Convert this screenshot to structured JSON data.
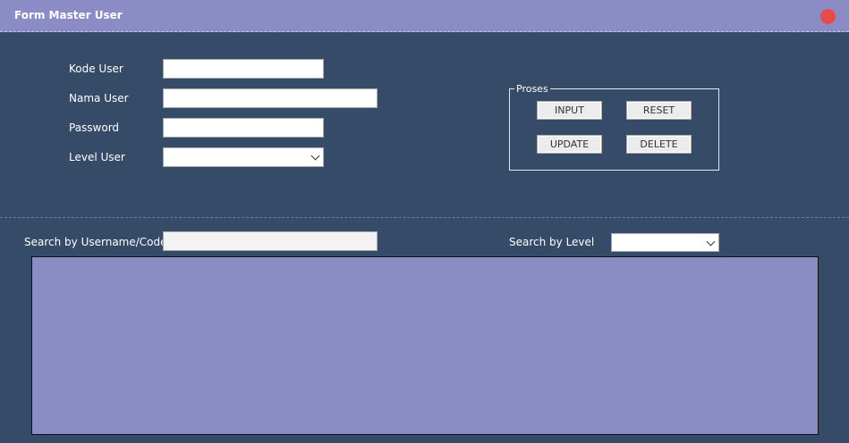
{
  "window": {
    "title": "Form Master User"
  },
  "form": {
    "kode_user_label": "Kode User",
    "kode_user_value": "",
    "nama_user_label": "Nama User",
    "nama_user_value": "",
    "password_label": "Password",
    "password_value": "",
    "level_user_label": "Level User",
    "level_user_value": ""
  },
  "proses": {
    "legend": "Proses",
    "input_label": "INPUT",
    "reset_label": "RESET",
    "update_label": "UPDATE",
    "delete_label": "DELETE"
  },
  "search": {
    "by_username_label": "Search by Username/Code",
    "by_username_value": "",
    "by_level_label": "Search by Level",
    "by_level_value": ""
  },
  "colors": {
    "background": "#364b68",
    "titlebar": "#8b8cc6",
    "close_button": "#e84a4a",
    "grid": "#8b8cc6"
  }
}
